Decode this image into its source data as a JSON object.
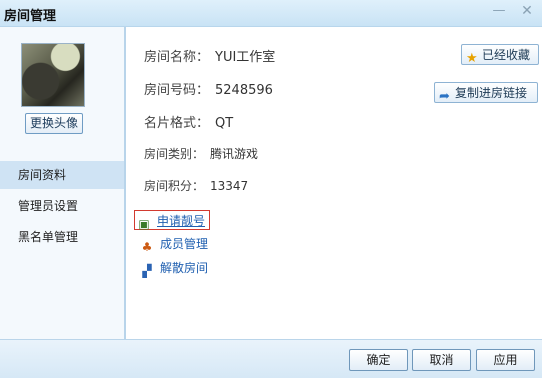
{
  "window": {
    "title": "房间管理",
    "minimize": "—",
    "close": "✕"
  },
  "sidebar": {
    "change_avatar": "更换头像",
    "items": [
      {
        "label": "房间资料",
        "active": true
      },
      {
        "label": "管理员设置",
        "active": false
      },
      {
        "label": "黑名单管理",
        "active": false
      }
    ]
  },
  "room": {
    "name_label": "房间名称：",
    "name_value": "YUI工作室",
    "id_label": "房间号码：",
    "id_value": "5248596",
    "card_label": "名片格式：",
    "card_value": "QT",
    "category_label": "房间类别：",
    "category_value": "腾讯游戏",
    "points_label": "房间积分：",
    "points_value": "13347"
  },
  "actions": {
    "favorited": "已经收藏",
    "copy_link": "复制进房链接"
  },
  "links": {
    "apply_number": "申请靓号",
    "member_manage": "成员管理",
    "dissolve_room": "解散房间"
  },
  "icons": {
    "star": "star-icon",
    "link": "link-icon",
    "apply": "certificate-icon",
    "members": "members-icon",
    "dissolve": "dissolve-icon"
  },
  "buttons": {
    "ok": "确定",
    "cancel": "取消",
    "apply": "应用"
  }
}
